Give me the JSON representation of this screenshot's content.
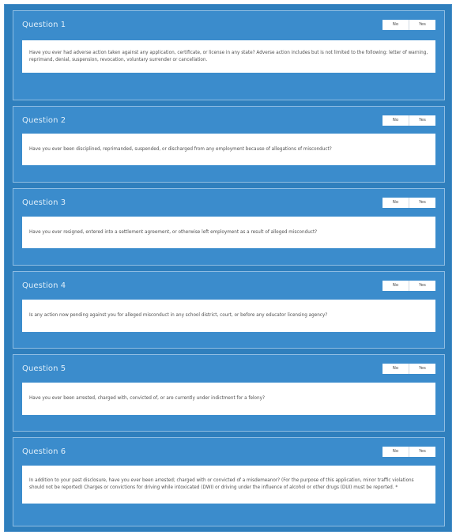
{
  "questions": [
    {
      "title": "Question 1",
      "no_label": "No",
      "yes_label": "Yes",
      "text": "Have you ever had adverse action taken against any application, certificate, or license in any state? Adverse action includes but is not limited to the following: letter of warning, reprimand, denial, suspension, revocation, voluntary surrender or cancellation."
    },
    {
      "title": "Question 2",
      "no_label": "No",
      "yes_label": "Yes",
      "text": "Have you ever been disciplined, reprimanded, suspended, or discharged from any employment because of allegations of misconduct?"
    },
    {
      "title": "Question 3",
      "no_label": "No",
      "yes_label": "Yes",
      "text": "Have you ever resigned, entered into a settlement agreement, or otherwise left employment as a result of alleged misconduct?"
    },
    {
      "title": "Question 4",
      "no_label": "No",
      "yes_label": "Yes",
      "text": "Is any action now pending against you for alleged misconduct in any school district, court, or before any educator licensing agency?"
    },
    {
      "title": "Question 5",
      "no_label": "No",
      "yes_label": "Yes",
      "text": "Have you ever been arrested, charged with, convicted of, or are currently under indictment for a felony?"
    },
    {
      "title": "Question 6",
      "no_label": "No",
      "yes_label": "Yes",
      "text": "In addition to your past disclosure, have you ever been arrested; charged with or convicted of a misdemeanor? (For the purpose of this application, minor traffic violations should not be reported) Charges or convictions for driving while intoxicated (DWI) or driving under the influence of alcohol or other drugs (DUI) must be reported. *"
    }
  ]
}
